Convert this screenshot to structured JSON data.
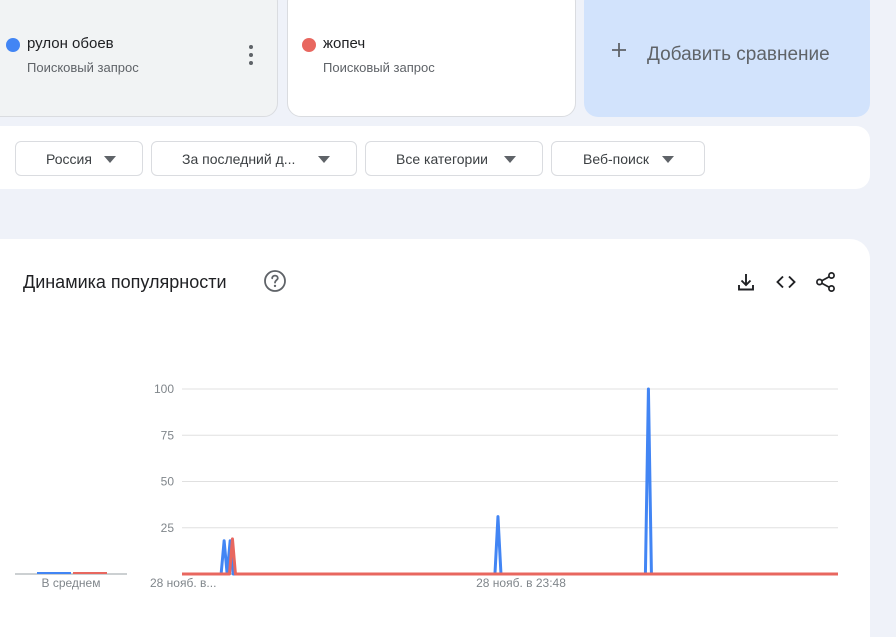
{
  "terms": [
    {
      "name": "рулон обоев",
      "subtitle": "Поисковый запрос",
      "color": "#4285f4"
    },
    {
      "name": "жопеч",
      "subtitle": "Поисковый запрос",
      "color": "#e8675f"
    }
  ],
  "add_comparison": {
    "label": "Добавить сравнение"
  },
  "filters": {
    "region": "Россия",
    "period": "За последний д...",
    "category": "Все категории",
    "search_type": "Веб-поиск"
  },
  "panel": {
    "title": "Динамика популярности"
  },
  "chart_data": {
    "type": "line",
    "title": "Динамика популярности",
    "y_ticks": [
      25,
      50,
      75,
      100
    ],
    "ylim": [
      0,
      100
    ],
    "grid": true,
    "x_tick_labels": [
      "28 нояб. в...",
      "28 нояб. в 23:48"
    ],
    "average_label": "В среднем",
    "averages": [
      1,
      0
    ],
    "series": [
      {
        "name": "рулон обоев",
        "color": "#4285f4",
        "values": [
          0,
          0,
          0,
          0,
          0,
          0,
          0,
          0,
          0,
          0,
          0,
          0,
          0,
          0,
          18,
          0,
          18,
          0,
          0,
          0,
          0,
          0,
          0,
          0,
          0,
          0,
          0,
          0,
          0,
          0,
          0,
          0,
          0,
          0,
          0,
          0,
          0,
          0,
          0,
          0,
          0,
          0,
          0,
          0,
          0,
          0,
          0,
          0,
          0,
          0,
          0,
          0,
          0,
          0,
          0,
          0,
          0,
          0,
          0,
          0,
          0,
          0,
          0,
          0,
          0,
          0,
          0,
          0,
          0,
          0,
          0,
          0,
          0,
          0,
          0,
          0,
          0,
          0,
          0,
          0,
          0,
          0,
          0,
          0,
          0,
          0,
          0,
          0,
          0,
          0,
          0,
          0,
          0,
          0,
          0,
          0,
          0,
          0,
          0,
          0,
          0,
          0,
          0,
          0,
          0,
          31,
          0,
          0,
          0,
          0,
          0,
          0,
          0,
          0,
          0,
          0,
          0,
          0,
          0,
          0,
          0,
          0,
          0,
          0,
          0,
          0,
          0,
          0,
          0,
          0,
          0,
          0,
          0,
          0,
          0,
          0,
          0,
          0,
          0,
          0,
          0,
          0,
          0,
          0,
          0,
          0,
          0,
          0,
          0,
          0,
          0,
          0,
          0,
          0,
          0,
          100,
          0,
          0,
          0,
          0,
          0,
          0,
          0,
          0,
          0,
          0,
          0,
          0,
          0,
          0,
          0,
          0,
          0,
          0,
          0,
          0,
          0,
          0,
          0,
          0,
          0,
          0,
          0,
          0,
          0,
          0,
          0,
          0,
          0,
          0,
          0,
          0,
          0,
          0,
          0,
          0,
          0,
          0,
          0,
          0,
          0,
          0,
          0,
          0,
          0,
          0,
          0,
          0,
          0,
          0,
          0,
          0,
          0,
          0,
          0,
          0,
          0,
          0,
          0
        ]
      },
      {
        "name": "жопеч",
        "color": "#e8675f",
        "values": [
          0,
          0,
          0,
          0,
          0,
          0,
          0,
          0,
          0,
          0,
          0,
          0,
          0,
          0,
          0,
          0,
          0,
          19,
          0,
          0,
          0,
          0,
          0,
          0,
          0,
          0,
          0,
          0,
          0,
          0,
          0,
          0,
          0,
          0,
          0,
          0,
          0,
          0,
          0,
          0,
          0,
          0,
          0,
          0,
          0,
          0,
          0,
          0,
          0,
          0,
          0,
          0,
          0,
          0,
          0,
          0,
          0,
          0,
          0,
          0,
          0,
          0,
          0,
          0,
          0,
          0,
          0,
          0,
          0,
          0,
          0,
          0,
          0,
          0,
          0,
          0,
          0,
          0,
          0,
          0,
          0,
          0,
          0,
          0,
          0,
          0,
          0,
          0,
          0,
          0,
          0,
          0,
          0,
          0,
          0,
          0,
          0,
          0,
          0,
          0,
          0,
          0,
          0,
          0,
          0,
          0,
          0,
          0,
          0,
          0,
          0,
          0,
          0,
          0,
          0,
          0,
          0,
          0,
          0,
          0,
          0,
          0,
          0,
          0,
          0,
          0,
          0,
          0,
          0,
          0,
          0,
          0,
          0,
          0,
          0,
          0,
          0,
          0,
          0,
          0,
          0,
          0,
          0,
          0,
          0,
          0,
          0,
          0,
          0,
          0,
          0,
          0,
          0,
          0,
          0,
          0,
          0,
          0,
          0,
          0,
          0,
          0,
          0,
          0,
          0,
          0,
          0,
          0,
          0,
          0,
          0,
          0,
          0,
          0,
          0,
          0,
          0,
          0,
          0,
          0,
          0,
          0,
          0,
          0,
          0,
          0,
          0,
          0,
          0,
          0,
          0,
          0,
          0,
          0,
          0,
          0,
          0,
          0,
          0,
          0,
          0,
          0,
          0,
          0,
          0,
          0,
          0,
          0,
          0,
          0,
          0,
          0,
          0,
          0,
          0,
          0,
          0,
          0,
          0,
          0,
          0,
          0
        ]
      }
    ]
  }
}
